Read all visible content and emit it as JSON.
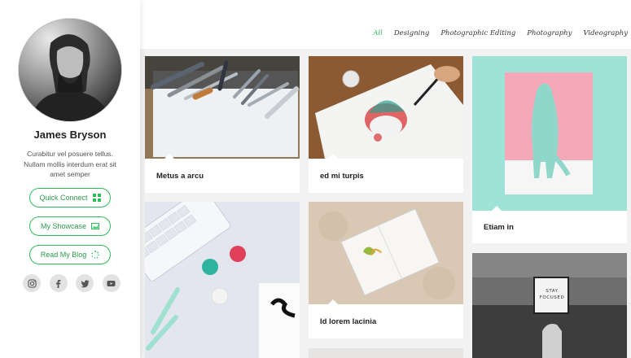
{
  "profile": {
    "name": "James Bryson",
    "bio": "Curabitur vel posuere tellus. Nullam mollis interdum erat sit amet semper"
  },
  "buttons": [
    {
      "label": "Quick Connect",
      "icon": "grid-icon"
    },
    {
      "label": "My Showcase",
      "icon": "image-icon"
    },
    {
      "label": "Read My Blog",
      "icon": "spinner-icon"
    }
  ],
  "socials": [
    "instagram-icon",
    "facebook-icon",
    "twitter-icon",
    "youtube-icon"
  ],
  "filters": {
    "all": "All",
    "designing": "Designing",
    "editing": "Photographic Editing",
    "photography": "Photography",
    "videography": "Videography"
  },
  "cards": [
    {
      "caption": "Metus a arcu"
    },
    {
      "caption": "ed mi turpis"
    },
    {
      "caption": "Etiam in"
    },
    {
      "caption": ""
    },
    {
      "caption": "Id lorem lacinia"
    },
    {
      "caption": ""
    }
  ],
  "overlay": {
    "sign": "STAY FOCUSED"
  },
  "colors": {
    "accent": "#2ebd59",
    "mint": "#9fe3d8",
    "pink": "#f5a8b8"
  }
}
